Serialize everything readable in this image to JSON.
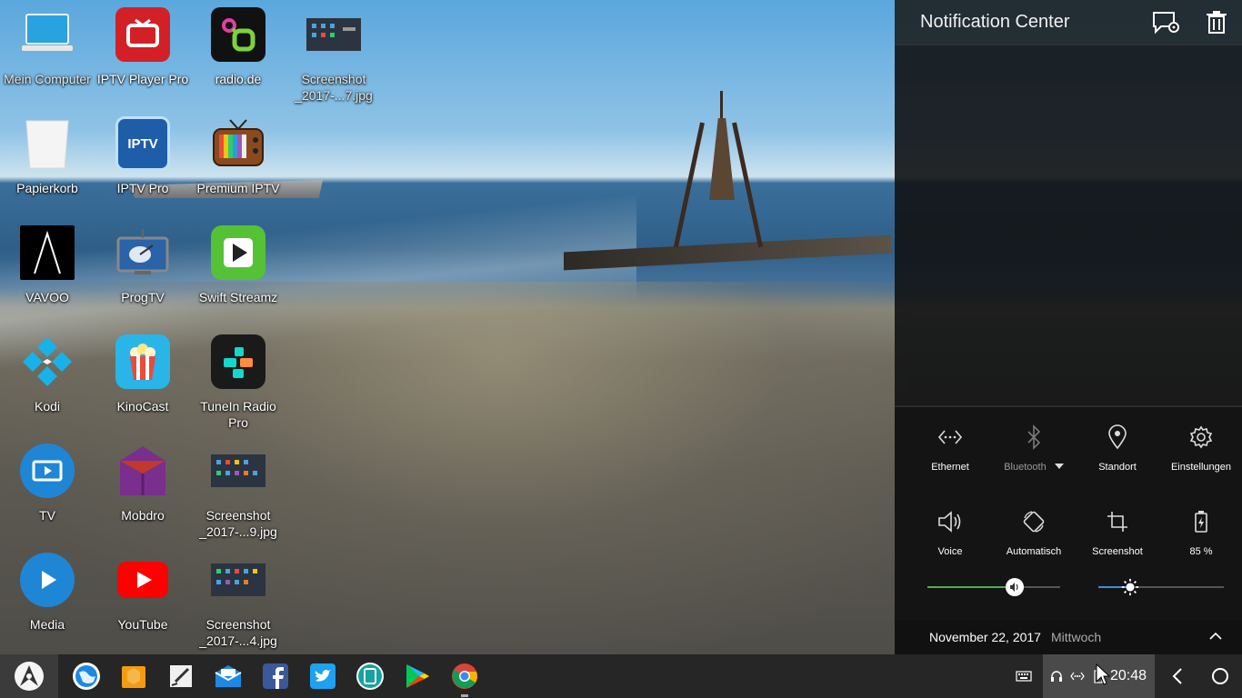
{
  "desktop": {
    "icons": [
      {
        "label": "Mein Computer",
        "icon": "laptop-icon",
        "color": "#29a3e0"
      },
      {
        "label": "IPTV Player Pro",
        "icon": "tv-icon",
        "color": "#d32027"
      },
      {
        "label": "radio.de",
        "icon": "radio-de-icon",
        "color": "#111111"
      },
      {
        "label": "Screenshot _2017-...7.jpg",
        "icon": "image-thumbnail-icon",
        "color": "#333333"
      },
      {
        "label": "Papierkorb",
        "icon": "trash-icon",
        "color": "#f2f2f2"
      },
      {
        "label": "IPTV Pro",
        "icon": "iptv-pro-icon",
        "color": "#1e5ea8"
      },
      {
        "label": "Premium IPTV",
        "icon": "retro-tv-icon",
        "color": "#6b3b1a"
      },
      {
        "label": "VAVOO",
        "icon": "vavoo-icon",
        "color": "#000000"
      },
      {
        "label": "ProgTV",
        "icon": "satellite-tv-icon",
        "color": "#2a63a8"
      },
      {
        "label": "Swift Streamz",
        "icon": "play-icon",
        "color": "#55c236"
      },
      {
        "label": "Kodi",
        "icon": "kodi-icon",
        "color": "#1f9bd8"
      },
      {
        "label": "KinoCast",
        "icon": "popcorn-icon",
        "color": "#29b5e8"
      },
      {
        "label": "TuneIn Radio Pro",
        "icon": "tunein-icon",
        "color": "#1a1a1a"
      },
      {
        "label": "TV",
        "icon": "tv-app-icon",
        "color": "#1f86d6"
      },
      {
        "label": "Mobdro",
        "icon": "mobdro-icon",
        "color": "#7a2e8e"
      },
      {
        "label": "Screenshot _2017-...9.jpg",
        "icon": "image-thumbnail-icon",
        "color": "#333333"
      },
      {
        "label": "Media",
        "icon": "media-play-icon",
        "color": "#1f86d6"
      },
      {
        "label": "YouTube",
        "icon": "youtube-icon",
        "color": "#ff0000"
      },
      {
        "label": "Screenshot _2017-...4.jpg",
        "icon": "image-thumbnail-icon",
        "color": "#333333"
      }
    ]
  },
  "notification_center": {
    "title": "Notification Center",
    "header_buttons": [
      "notification-settings-icon",
      "clear-all-icon"
    ],
    "quick_settings": [
      {
        "label": "Ethernet",
        "icon": "ethernet-icon",
        "enabled": true
      },
      {
        "label": "Bluetooth",
        "icon": "bluetooth-icon",
        "enabled": false,
        "has_dropdown": true
      },
      {
        "label": "Standort",
        "icon": "location-icon",
        "enabled": true
      },
      {
        "label": "Einstellungen",
        "icon": "gear-icon",
        "enabled": true
      },
      {
        "label": "Voice",
        "icon": "volume-icon",
        "enabled": true
      },
      {
        "label": "Automatisch",
        "icon": "auto-rotate-icon",
        "enabled": true
      },
      {
        "label": "Screenshot",
        "icon": "crop-icon",
        "enabled": true
      },
      {
        "label": "85 %",
        "icon": "battery-icon",
        "enabled": true
      }
    ],
    "sliders": {
      "volume": {
        "level": 0.66,
        "color": "#4caf50",
        "icon": "volume-icon"
      },
      "brightness": {
        "level": 0.25,
        "color": "#3f8ede",
        "icon": "brightness-icon"
      }
    },
    "date": "November 22, 2017",
    "weekday": "Mittwoch"
  },
  "taskbar": {
    "start_icon": "start-menu-icon",
    "apps": [
      {
        "name": "browser-globe-icon",
        "color": "#1e88e5"
      },
      {
        "name": "file-manager-icon",
        "color": "#f39c12"
      },
      {
        "name": "notes-icon",
        "color": "#e0e0e0"
      },
      {
        "name": "email-icon",
        "color": "#1e88e5"
      },
      {
        "name": "facebook-icon",
        "color": "#3b5998"
      },
      {
        "name": "twitter-icon",
        "color": "#1da1f2"
      },
      {
        "name": "tablet-mode-icon",
        "color": "#17a2a2"
      },
      {
        "name": "play-store-icon",
        "color": "#00c853"
      },
      {
        "name": "chrome-icon",
        "color": "#db4437"
      }
    ],
    "tray_icons": [
      "keyboard-icon",
      "headset-icon",
      "ethernet-icon",
      "battery-icon"
    ],
    "clock": "20:48"
  }
}
